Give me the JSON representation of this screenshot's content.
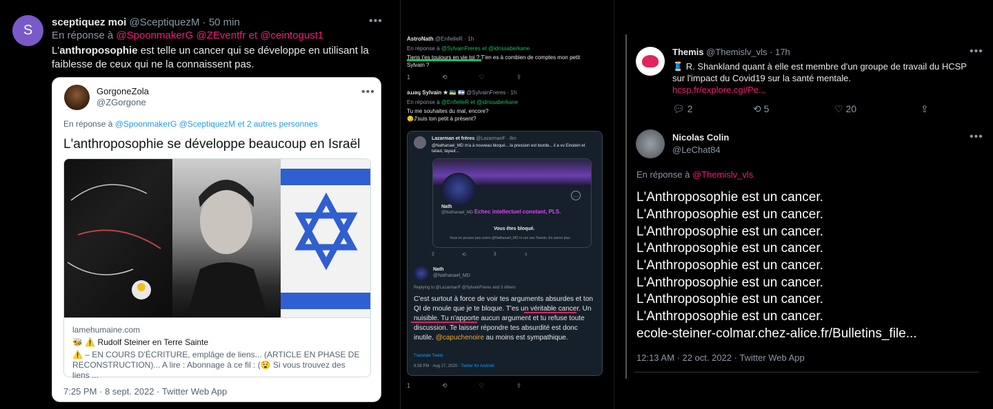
{
  "panel1": {
    "avatar_letter": "S",
    "author_name": "sceptiquez moi",
    "author_handle": "@SceptiquezM",
    "time_sep": "·",
    "time": "50 min",
    "reply_prefix": "En réponse à",
    "reply_user1": "@SpoonmakerG",
    "reply_user2": "@ZEventfr",
    "reply_and": "et",
    "reply_user3": "@ceintogust1",
    "text_prefix": "L'",
    "text_bold": "anthroposophie",
    "text_rest": " est telle un cancer qui se développe en utilisant la faiblesse de ceux qui ne la connaissent pas.",
    "quote": {
      "name": "GorgoneZola",
      "handle": "@ZGorgone",
      "reply_prefix": "En réponse à",
      "reply_users": "@SpoonmakerG @SceptiquezM",
      "reply_more": "et 2 autres personnes",
      "text": "L'anthroposophie se développe beaucoup en Israël",
      "link_domain": "lamehumaine.com",
      "link_title": "🐝 ⚠️ Rudolf Steiner en Terre Sainte",
      "link_desc": "⚠️ – EN COURS D'ÉCRITURE, emplâge de liens... (ARTICLE EN PHASE DE RECONSTRUCTION)... A lire : Abonnage à ce fil : (😧 Si vous trouvez des liens ...",
      "timestamp": "7:25 PM · 8 sept. 2022 · Twitter Web App"
    }
  },
  "panel2": {
    "t1_name": "AstroNath",
    "t1_handle": "@EnfielleR · 1h",
    "t1_reply_prefix": "En réponse à",
    "t1_reply_users": "@SylvainFreres  et  @idrissaberkane",
    "t1_text_green": "Tiens t'es toujours en vie toi ?",
    "t1_text_rest": " T'en es à combien de comptes mon petit Sylvain ?",
    "t1_actions": [
      "1",
      "",
      "",
      ""
    ],
    "t2_name": "ǝɹɹǝıɟ Sylvain ★ 🇺🇦 🇮🇱",
    "t2_handle": "@SylvainFreres · 1h",
    "t2_reply_prefix": "En réponse à",
    "t2_reply_users": "@EnfielleR  et  @idrissaberkane",
    "t2_text1": "Tu me souhaites du mal, encore?",
    "t2_text2": "😏J'suis ton petit à présent?",
    "inner_name": "Lazarman et frères",
    "inner_handle": "@LazarmanF · 8m",
    "inner_text": "@Nathanael_MD m'a à nouveau bloqué... la pression est lourde... il a vu Einstein et taïaut, tayaut...",
    "nath_name": "Nath",
    "nath_handle": "@Nathanael_MD",
    "nath_bio": "Echec intellectuel constant, PLS.",
    "blocked": "Vous êtes bloqué.",
    "blocked_sub": "Vous ne pouvez pas suivre @Nathanael_MD ni voir ses Tweets. En savoir plus",
    "inner_actions": [
      "2",
      "",
      "3",
      ""
    ],
    "nath2_name": "Nath",
    "nath2_handle": "@Nathanael_MD",
    "replying_to": "Replying to @LazarmanF @SylvainFreres and 3 others",
    "nath_text_1": "C'est surtout à force de voir tes arguments absurdes et ton QI de moule que je te bloque. ",
    "nath_text_2": "T'es un véritable cancer. Un nuisible.",
    "nath_text_3": " Tu n'apporte aucun argument et tu refuse toute discussion. Te laisser répondre tes absurdité est donc inutile.",
    "nath_text_mention": "@capuchenoire",
    "nath_text_4": " au moins est sympathique.",
    "translate": "Translate Tweet",
    "nath_time": "9:38 PM · Aug 27, 2020 · ",
    "nath_client": "Twitter for Android",
    "outer_actions": [
      "1",
      "",
      "",
      ""
    ]
  },
  "panel3": {
    "t_name": "Themis",
    "t_handle": "@Themislv_vls · 17h",
    "t_text": "🧵 R. Shankland quant à elle est membre d'un groupe de travail du HCSP sur l'impact du Covid19 sur la santé mentale.",
    "t_link": "hcsp.fr/explore.cgi/Pe...",
    "t_replies": "2",
    "t_retweets": "5",
    "t_likes": "20",
    "n_name": "Nicolas Colin",
    "n_handle": "@LeChat84",
    "n_reply_prefix": "En réponse à",
    "n_reply_user": "@Themislv_vls",
    "lines": [
      "L'Anthroposophie est un cancer.",
      "L'Anthroposophie est un cancer.",
      "L'Anthroposophie est un cancer.",
      "L'Anthroposophie est un cancer.",
      "L'Anthroposophie est un cancer.",
      "L'Anthroposophie est un cancer.",
      "L'Anthroposophie est un cancer.",
      "L'Anthroposophie est un cancer."
    ],
    "n_link": "ecole-steiner-colmar.chez-alice.fr/Bulletins_file...",
    "n_time": "12:13 AM · 22 oct. 2022 · Twitter Web App"
  },
  "colors": {
    "accent_pink": "#f91880",
    "accent_blue": "#1d9bf0",
    "accent_green": "#17bf63",
    "underline_red": "#e0245e"
  }
}
